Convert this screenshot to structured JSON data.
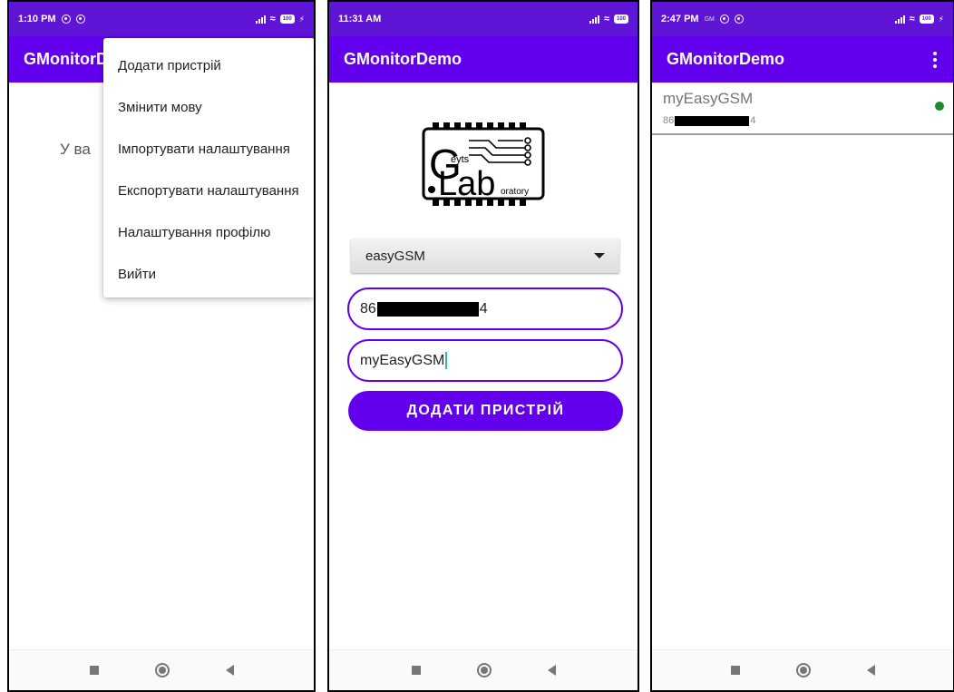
{
  "screens": [
    {
      "status_bar": {
        "time": "1:10 PM",
        "battery": "100"
      },
      "app_bar": {
        "title": "GMonitorD"
      },
      "empty_text": "У ва",
      "menu": {
        "items": [
          {
            "label": "Додати пристрій"
          },
          {
            "label": "Змінити мову"
          },
          {
            "label": "Імпортувати налаштування"
          },
          {
            "label": "Експортувати налаштування"
          },
          {
            "label": "Налаштування профілю"
          },
          {
            "label": "Вийти"
          }
        ]
      }
    },
    {
      "status_bar": {
        "time": "11:31 AM",
        "battery": "100"
      },
      "app_bar": {
        "title": "GMonitorDemo"
      },
      "logo": {
        "letter_g": "G",
        "eyts": "eyts",
        "lab": "Lab",
        "oratory": "oratory"
      },
      "device_type": {
        "value": "easyGSM"
      },
      "phone_field": {
        "prefix": "86",
        "suffix": "4"
      },
      "name_field": {
        "value": "myEasyGSM"
      },
      "add_button": {
        "label": "ДОДАТИ ПРИСТРІЙ"
      }
    },
    {
      "status_bar": {
        "time": "2:47 PM",
        "extra": "GM",
        "battery": "100"
      },
      "app_bar": {
        "title": "GMonitorDemo"
      },
      "devices": [
        {
          "name": "myEasyGSM",
          "number_prefix": "86",
          "number_suffix": "4",
          "status_color": "#1a8a2a"
        }
      ]
    }
  ],
  "colors": {
    "primary": "#6200ee",
    "status_bar": "#5e15d6",
    "online": "#1a8a2a"
  },
  "icons": {
    "nav": [
      "recent-apps-icon",
      "home-icon",
      "back-icon"
    ],
    "status": [
      "do-not-disturb-icon",
      "signal-icon",
      "wifi-icon",
      "battery-icon",
      "charging-icon"
    ],
    "app_bar": [
      "overflow-menu-icon"
    ],
    "spinner": [
      "dropdown-arrow-icon"
    ]
  }
}
